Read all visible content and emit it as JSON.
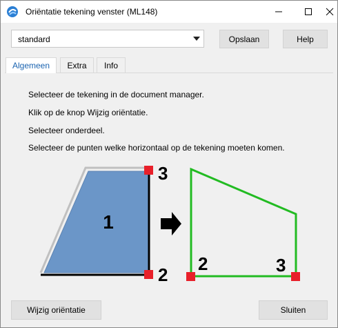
{
  "window": {
    "title": "Oriëntatie tekening venster (ML148)",
    "icon": "app-logo-icon"
  },
  "toolbar": {
    "preset_value": "standard",
    "save_label": "Opslaan",
    "help_label": "Help"
  },
  "tabs": [
    {
      "label": "Algemeen",
      "active": true
    },
    {
      "label": "Extra",
      "active": false
    },
    {
      "label": "Info",
      "active": false
    }
  ],
  "instructions": [
    "Selecteer de tekening in de document manager.",
    "Klik op de knop Wijzig oriëntatie.",
    "Selecteer onderdeel.",
    "Selecteer de punten welke horizontaal op de tekening moeten komen."
  ],
  "diagram": {
    "part_label": "1",
    "point_labels_before": [
      "3",
      "2"
    ],
    "point_labels_after": [
      "2",
      "3"
    ],
    "colors": {
      "part_fill": "#6b96c8",
      "marker": "#e8202a",
      "outline_after": "#22bb22",
      "arrow": "#000000"
    }
  },
  "footer": {
    "change_label": "Wijzig oriëntatie",
    "close_label": "Sluiten"
  }
}
